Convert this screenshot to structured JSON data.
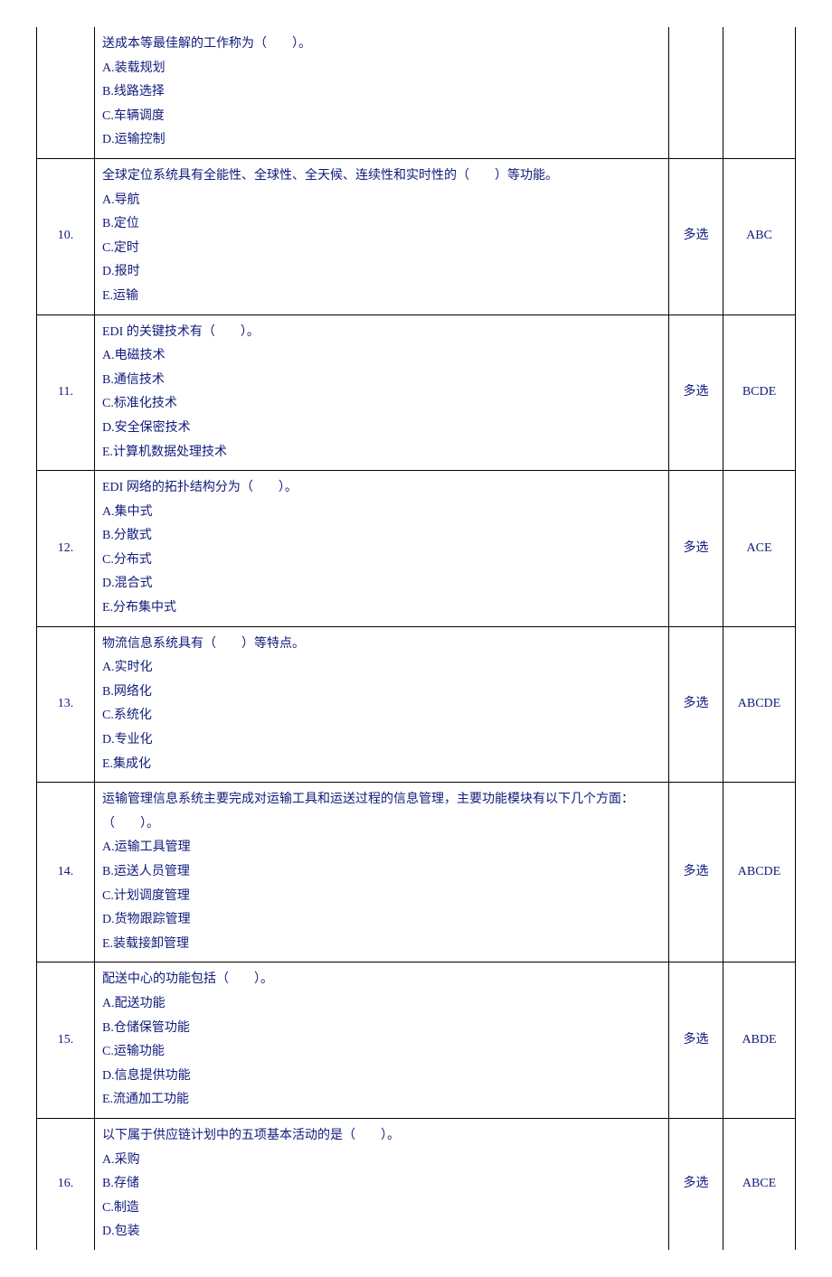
{
  "rows": [
    {
      "num": "",
      "lines": [
        "送成本等最佳解的工作称为（　　）。",
        "A.装载规划",
        "B.线路选择",
        "C.车辆调度",
        "D.运输控制"
      ],
      "type": "",
      "answer": ""
    },
    {
      "num": "10.",
      "lines": [
        "全球定位系统具有全能性、全球性、全天候、连续性和实时性的（　　）等功能。",
        "A.导航",
        "B.定位",
        "C.定时",
        "D.报时",
        "E.运输"
      ],
      "type": "多选",
      "answer": "ABC"
    },
    {
      "num": "11.",
      "lines": [
        "EDI 的关键技术有（　　）。",
        "A.电磁技术",
        "B.通信技术",
        "C.标准化技术",
        "D.安全保密技术",
        "E.计算机数据处理技术"
      ],
      "type": "多选",
      "answer": "BCDE"
    },
    {
      "num": "12.",
      "lines": [
        "EDI 网络的拓扑结构分为（　　）。",
        "A.集中式",
        "B.分散式",
        "C.分布式",
        "D.混合式",
        "E.分布集中式"
      ],
      "type": "多选",
      "answer": "ACE"
    },
    {
      "num": "13.",
      "lines": [
        "物流信息系统具有（　　）等特点。",
        "A.实时化",
        "B.网络化",
        "C.系统化",
        "D.专业化",
        "E.集成化"
      ],
      "type": "多选",
      "answer": "ABCDE"
    },
    {
      "num": "14.",
      "lines": [
        "运输管理信息系统主要完成对运输工具和运送过程的信息管理，主要功能模块有以下几个方面：",
        "（　　）。",
        "A.运输工具管理",
        "B.运送人员管理",
        "C.计划调度管理",
        "D.货物跟踪管理",
        "E.装载接卸管理"
      ],
      "type": "多选",
      "answer": "ABCDE"
    },
    {
      "num": "15.",
      "lines": [
        "配送中心的功能包括（　　）。",
        "A.配送功能",
        "B.仓储保管功能",
        "C.运输功能",
        "D.信息提供功能",
        "E.流通加工功能"
      ],
      "type": "多选",
      "answer": "ABDE"
    },
    {
      "num": "16.",
      "lines": [
        "以下属于供应链计划中的五项基本活动的是（　　）。",
        "A.采购",
        "B.存储",
        "C.制造",
        "D.包装"
      ],
      "type": "多选",
      "answer": "ABCE"
    }
  ]
}
